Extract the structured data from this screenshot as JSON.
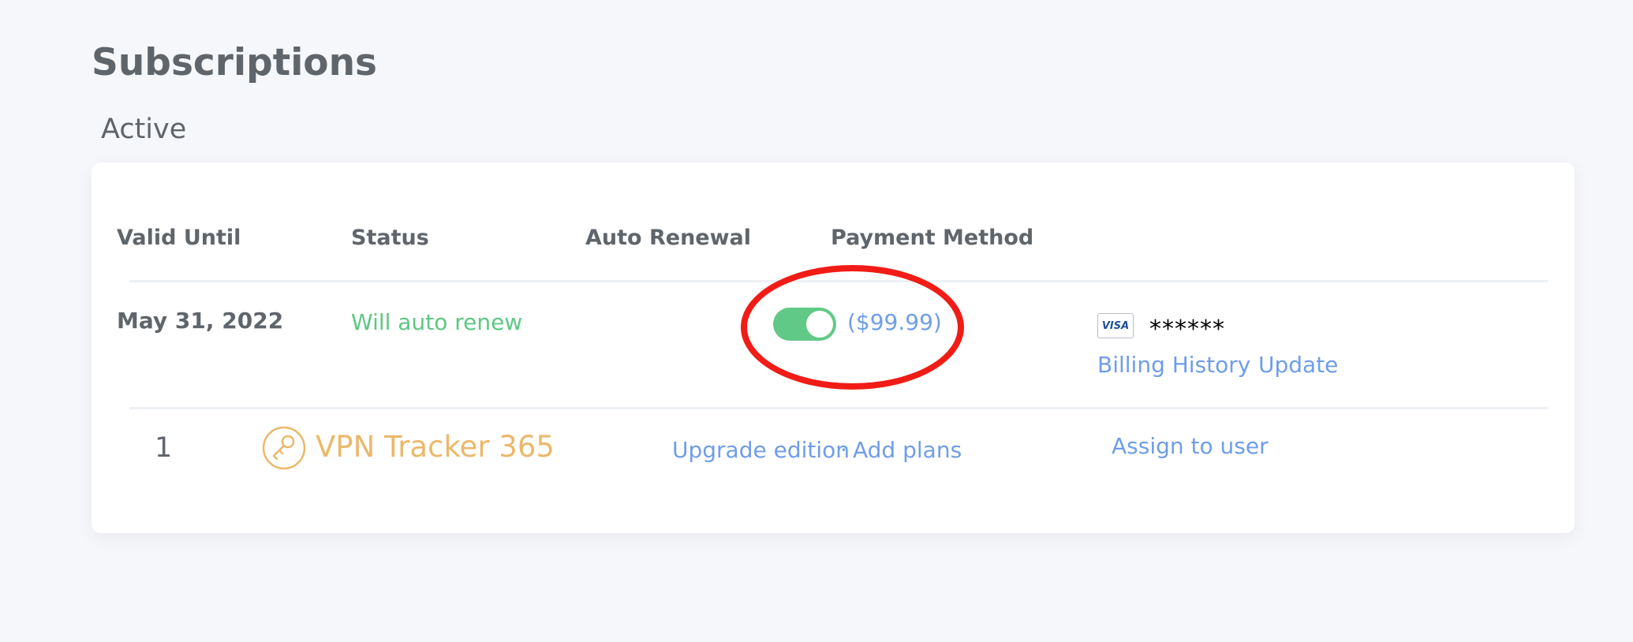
{
  "page": {
    "title": "Subscriptions",
    "section": "Active"
  },
  "table": {
    "headers": [
      "Valid Until",
      "Status",
      "Auto Renewal",
      "Payment Method"
    ],
    "row": {
      "valid_until": "May 31, 2022",
      "status": "Will auto renew",
      "auto_renewal": {
        "enabled": true,
        "price": "($99.99)"
      },
      "payment": {
        "card_brand": "VISA",
        "masked_number": "******",
        "billing_history": "Billing History",
        "update": "Update"
      }
    },
    "product": {
      "count": "1",
      "name": "VPN Tracker 365",
      "upgrade_edition": "Upgrade edition",
      "separator": "·",
      "add_plans": "Add plans",
      "assign_to_user": "Assign to user"
    }
  },
  "colors": {
    "accent_blue": "#6f9de9",
    "success_green": "#5fc782",
    "toggle_green": "#61c987",
    "product_orange": "#ebb86b",
    "highlight_red": "#f11c16"
  },
  "icons": [
    "visa-card-icon",
    "key-icon"
  ]
}
